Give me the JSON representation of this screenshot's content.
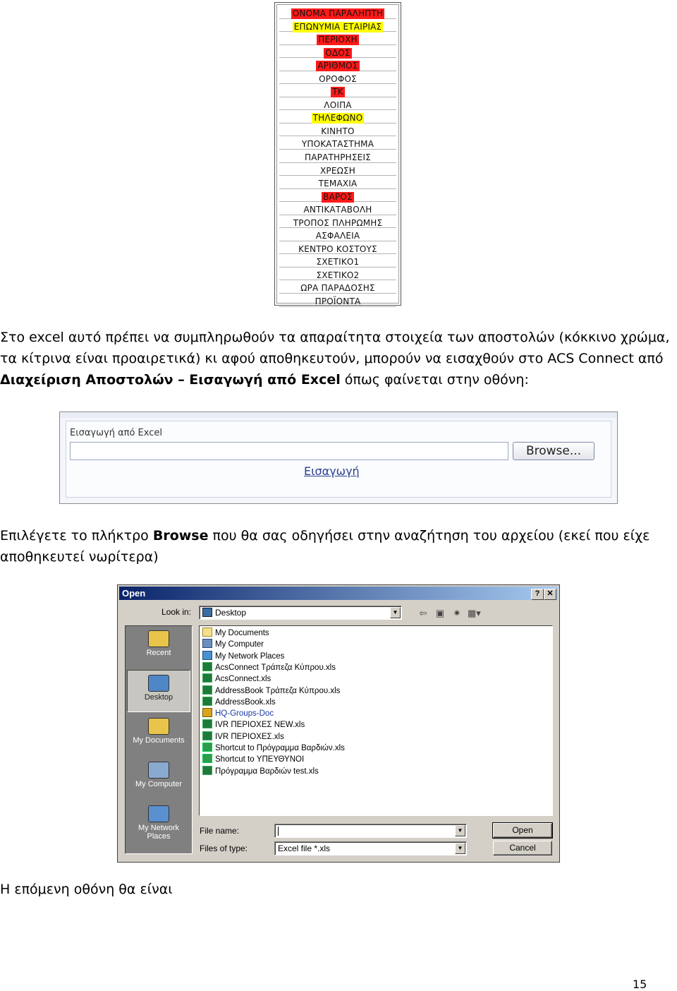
{
  "fields": [
    {
      "label": "ΟΝΟΜΑ ΠΑΡΑΛΗΠΤΗ",
      "status": "required"
    },
    {
      "label": "ΕΠΩΝΥΜΙΑ ΕΤΑΙΡΙΑΣ",
      "status": "optional"
    },
    {
      "label": "ΠΕΡΙΟΧΗ",
      "status": "required"
    },
    {
      "label": "ΟΔΟΣ",
      "status": "required"
    },
    {
      "label": "ΑΡΙΘΜΟΣ",
      "status": "required"
    },
    {
      "label": "ΟΡΟΦΟΣ",
      "status": "none"
    },
    {
      "label": "ΤΚ",
      "status": "required"
    },
    {
      "label": "ΛΟΙΠΑ",
      "status": "none"
    },
    {
      "label": "ΤΗΛΕΦΩΝΟ",
      "status": "optional"
    },
    {
      "label": "ΚΙΝΗΤΟ",
      "status": "none"
    },
    {
      "label": "ΥΠΟΚΑΤΑΣΤΗΜΑ",
      "status": "none"
    },
    {
      "label": "ΠΑΡΑΤΗΡΗΣΕΙΣ",
      "status": "none"
    },
    {
      "label": "ΧΡΕΩΣΗ",
      "status": "none"
    },
    {
      "label": "ΤΕΜΑΧΙΑ",
      "status": "none"
    },
    {
      "label": "ΒΑΡΟΣ",
      "status": "required"
    },
    {
      "label": "ΑΝΤΙΚΑΤΑΒΟΛΗ",
      "status": "none"
    },
    {
      "label": "ΤΡΟΠΟΣ ΠΛΗΡΩΜΗΣ",
      "status": "none"
    },
    {
      "label": "ΑΣΦΑΛΕΙΑ",
      "status": "none"
    },
    {
      "label": "ΚΕΝΤΡΟ ΚΟΣΤΟΥΣ",
      "status": "none"
    },
    {
      "label": "ΣΧΕΤΙΚΟ1",
      "status": "none"
    },
    {
      "label": "ΣΧΕΤΙΚΟ2",
      "status": "none"
    },
    {
      "label": "ΩΡΑ ΠΑΡΑΔΟΣΗΣ",
      "status": "none"
    },
    {
      "label": "ΠΡΟΪΟΝΤΑ",
      "status": "none"
    }
  ],
  "colors": {
    "required": "#ff1a1a",
    "optional": "#ffff00"
  },
  "paragraph1": {
    "line1": "Στο excel αυτό πρέπει να συμπληρωθούν τα απαραίτητα στοιχεία των αποστολών (κόκκινο χρώμα,",
    "line2": "τα κίτρινα είναι προαιρετικά) κι αφού αποθηκευτούν, μπορούν να εισαχθούν στο ACS Connect από",
    "line3_bold": "Διαχείριση Αποστολών – Εισαγωγή από Excel",
    "line3_rest": " όπως φαίνεται στην οθόνη:"
  },
  "import_panel": {
    "title": "Εισαγωγή από Excel",
    "browse_label": "Browse...",
    "import_link": "Εισαγωγή"
  },
  "paragraph2": {
    "line1_pre": "Επιλέγετε το πλήκτρο ",
    "line1_bold": "Browse",
    "line1_post": " που θα σας οδηγήσει στην αναζήτηση του αρχείου (εκεί που είχε",
    "line2": "αποθηκευτεί νωρίτερα)"
  },
  "open_dialog": {
    "title": "Open",
    "help_btn": "?",
    "close_btn": "✕",
    "look_in_label": "Look in:",
    "look_in_value": "Desktop",
    "places": [
      {
        "label": "Recent",
        "icon": "folder-icon"
      },
      {
        "label": "Desktop",
        "icon": "desktop-icon"
      },
      {
        "label": "My Documents",
        "icon": "documents-icon"
      },
      {
        "label": "My Computer",
        "icon": "computer-icon"
      },
      {
        "label": "My Network Places",
        "icon": "network-icon"
      }
    ],
    "files": [
      {
        "name": "My Documents",
        "kind": "doc"
      },
      {
        "name": "My Computer",
        "kind": "pc"
      },
      {
        "name": "My Network Places",
        "kind": "net"
      },
      {
        "name": "AcsConnect Τράπεζα Κύπρου.xls",
        "kind": "xls"
      },
      {
        "name": "AcsConnect.xls",
        "kind": "xls"
      },
      {
        "name": "AddressBook Τράπεζα Κύπρου.xls",
        "kind": "xls"
      },
      {
        "name": "AddressBook.xls",
        "kind": "xls"
      },
      {
        "name": "HQ-Groups-Doc",
        "kind": "grp"
      },
      {
        "name": "IVR ΠΕΡΙΟΧΕΣ NEW.xls",
        "kind": "xls"
      },
      {
        "name": "IVR ΠΕΡΙΟΧΕΣ.xls",
        "kind": "xls"
      },
      {
        "name": "Shortcut to Πρόγραμμα Βαρδιών.xls",
        "kind": "sc"
      },
      {
        "name": "Shortcut to ΥΠΕΥΘΥΝΟΙ",
        "kind": "sc"
      },
      {
        "name": "Πρόγραμμα Βαρδιών test.xls",
        "kind": "xls"
      }
    ],
    "file_name_label": "File name:",
    "file_name_value": "",
    "file_type_label": "Files of type:",
    "file_type_value": "Excel file *.xls",
    "open_btn": "Open",
    "cancel_btn": "Cancel"
  },
  "paragraph3": "Η επόμενη οθόνη θα είναι",
  "page_number": "15"
}
